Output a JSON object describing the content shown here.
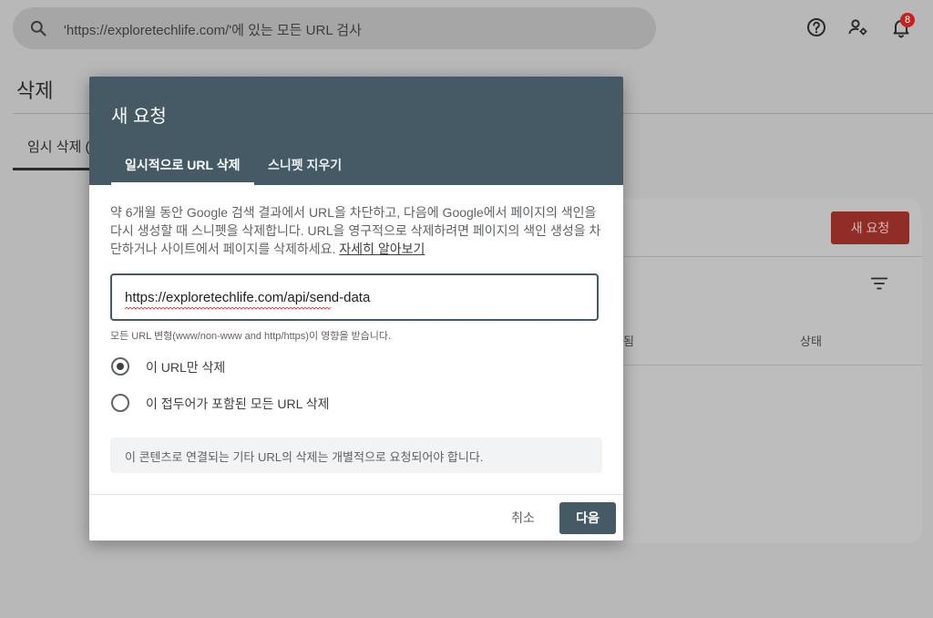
{
  "search": {
    "text": "'https://exploretechlife.com/'에 있는 모든 URL 검사"
  },
  "header": {
    "notification_count": "8"
  },
  "page": {
    "title": "삭제",
    "tab_label": "임시 삭제 (",
    "new_request_label": "새 요청",
    "column_headers": [
      "됨",
      "상태"
    ]
  },
  "dialog": {
    "title": "새 요청",
    "tabs": [
      {
        "label": "일시적으로 URL 삭제",
        "active": true
      },
      {
        "label": "스니펫 지우기",
        "active": false
      }
    ],
    "description": "약 6개월 동안 Google 검색 결과에서 URL을 차단하고, 다음에 Google에서 페이지의 색인을 다시 생성할 때 스니펫을 삭제합니다. URL을 영구적으로 삭제하려면 페이지의 색인 생성을 차단하거나 사이트에서 페이지를 삭제하세요.",
    "learn_more": "자세히 알아보기",
    "url_value": "https://exploretechlife.com/api/send-data",
    "helper_text": "모든 URL 변형(www/non-www and http/https)이 영향을 받습니다.",
    "radio_options": [
      {
        "label": "이 URL만 삭제",
        "selected": true
      },
      {
        "label": "이 접두어가 포함된 모든 URL 삭제",
        "selected": false
      }
    ],
    "info_text": "이 콘텐츠로 연결되는 기타 URL의 삭제는 개별적으로 요청되어야 합니다.",
    "cancel_label": "취소",
    "next_label": "다음"
  },
  "colors": {
    "dialog_header": "#455a64",
    "primary_button": "#455a64",
    "new_request_button": "#c5221f",
    "badge": "#c5221f"
  }
}
